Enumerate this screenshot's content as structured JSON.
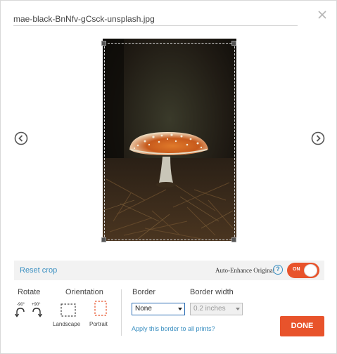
{
  "dialog": {
    "filename": "mae-black-BnNfv-gCsck-unsplash.jpg",
    "close_icon": "close-icon",
    "prev_icon": "chevron-left-circle-icon",
    "next_icon": "chevron-right-circle-icon"
  },
  "toolbar": {
    "reset_crop": "Reset crop",
    "auto_enhance_label": "Auto-Enhance Original",
    "help_glyph": "?",
    "toggle_label": "ON",
    "toggle_on": true
  },
  "rotate": {
    "label": "Rotate",
    "left_degrees": "-90°",
    "right_degrees": "+90°"
  },
  "orientation": {
    "label": "Orientation",
    "landscape": "Landscape",
    "portrait": "Portrait",
    "selected": "Portrait"
  },
  "border": {
    "label": "Border",
    "value": "None",
    "width_label": "Border width",
    "width_value": "0.2 inches",
    "apply_all": "Apply this border to all prints?"
  },
  "actions": {
    "done": "DONE"
  },
  "colors": {
    "accent": "#e8532b",
    "link": "#3a8fc1"
  }
}
